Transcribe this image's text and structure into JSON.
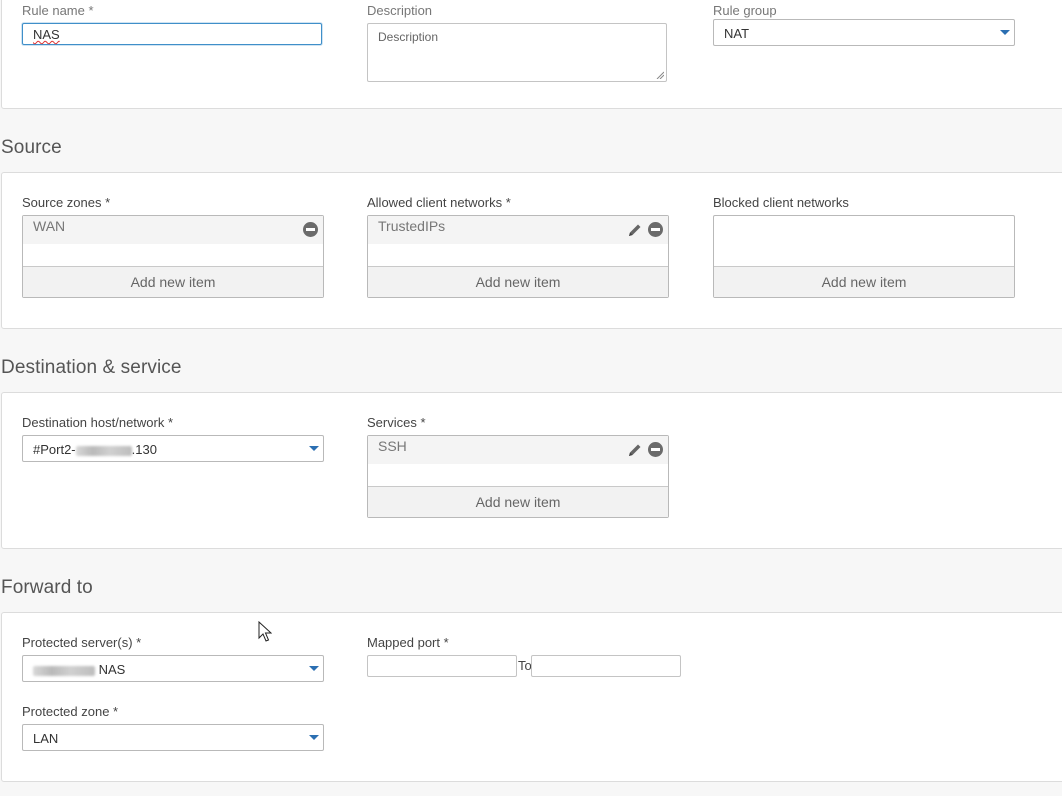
{
  "general": {
    "rule_name_label": "Rule name *",
    "rule_name_value": "NAS",
    "description_label": "Description",
    "description_placeholder": "Description",
    "rule_group_label": "Rule group",
    "rule_group_value": "NAT"
  },
  "source": {
    "title": "Source",
    "source_zones_label": "Source zones *",
    "source_zones_items": [
      "WAN"
    ],
    "allowed_label": "Allowed client networks *",
    "allowed_items": [
      "TrustedIPs"
    ],
    "blocked_label": "Blocked client networks",
    "add_new_label": "Add new item"
  },
  "destination": {
    "title": "Destination & service",
    "dest_label": "Destination host/network *",
    "dest_value_prefix": "#Port2-",
    "dest_value_suffix": ".130",
    "services_label": "Services *",
    "services_items": [
      "SSH"
    ],
    "add_new_label": "Add new item"
  },
  "forward": {
    "title": "Forward to",
    "protected_servers_label": "Protected server(s) *",
    "protected_servers_suffix": "NAS",
    "mapped_port_label": "Mapped port *",
    "to_label": "To",
    "protected_zone_label": "Protected zone *",
    "protected_zone_value": "LAN"
  },
  "icons": {
    "remove": "remove-circle-icon",
    "edit": "pencil-icon",
    "caret": "chevron-down-icon",
    "cursor": "mouse-pointer-icon"
  },
  "colors": {
    "accent": "#2b6fb2",
    "focus_border": "#3f8fc9",
    "page_bg": "#f7f7f7",
    "panel_bg": "#ffffff"
  }
}
